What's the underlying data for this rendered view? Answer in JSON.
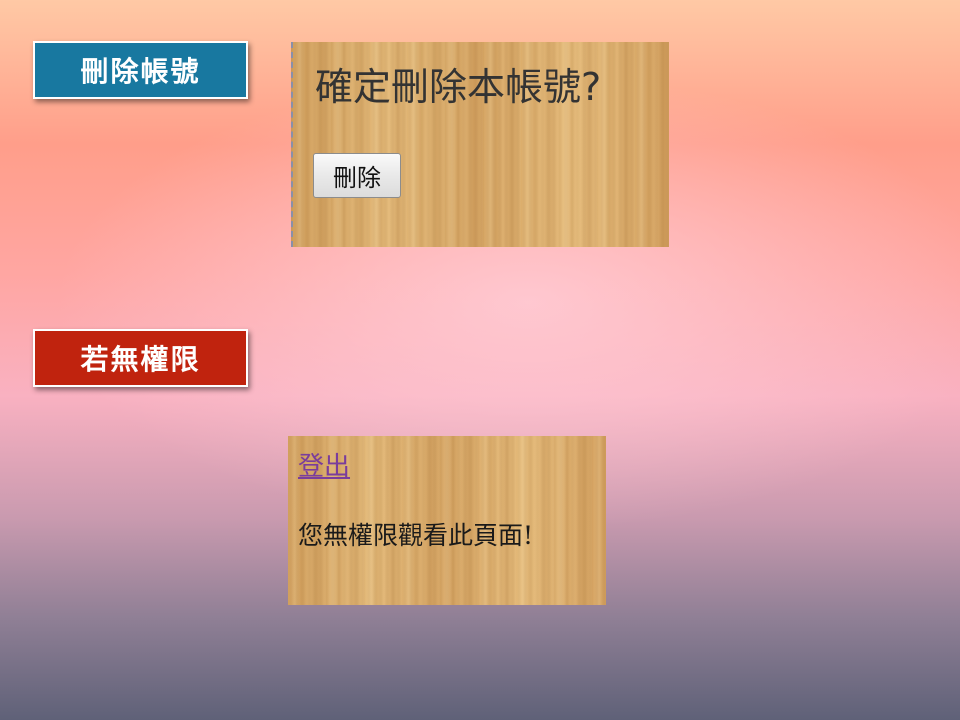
{
  "sections": {
    "delete_account": {
      "title": "刪除帳號",
      "title_color": "#1878a0",
      "panel": {
        "prompt": "確定刪除本帳號?",
        "button_label": "刪除"
      }
    },
    "no_permission": {
      "title": "若無權限",
      "title_color": "#c0230e",
      "panel": {
        "logout_link": "登出",
        "message": "您無權限觀看此頁面!"
      }
    }
  },
  "colors": {
    "link": "#7a3d9c",
    "wood": "#d7a866"
  }
}
